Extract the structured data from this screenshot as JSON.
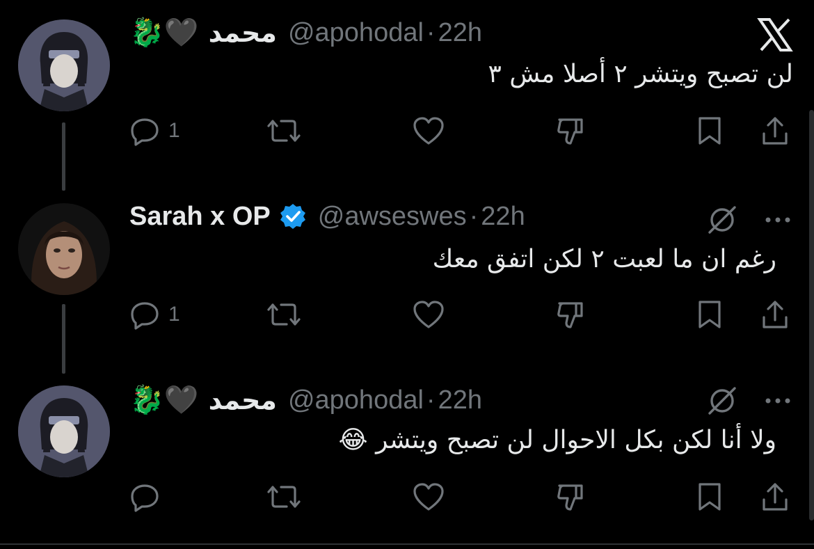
{
  "tweets": [
    {
      "display_name": "محمد",
      "name_emojis": "🐉🖤",
      "handle": "@apohodal",
      "separator": "·",
      "time": "22h",
      "text": "لن تصبح ويتشر ٢ أصلا مش ٣",
      "reply_count": "1",
      "top_icon": "x-logo-icon"
    },
    {
      "display_name": "Sarah x OP",
      "verified": true,
      "handle": "@awseswes",
      "separator": "·",
      "time": "22h",
      "text": "رغم ان ما لعبت ٢ لكن اتفق معك",
      "reply_count": "1",
      "top_icon": "grok-icon"
    },
    {
      "display_name": "محمد",
      "name_emojis": "🐉🖤",
      "handle": "@apohodal",
      "separator": "·",
      "time": "22h",
      "text": "ولا أنا لكن بكل الاحوال لن تصبح ويتشر",
      "text_emoji": "😂",
      "reply_count": "",
      "top_icon": "grok-icon"
    }
  ],
  "colors": {
    "background": "#000000",
    "text": "#e7e9ea",
    "muted": "#71767b",
    "verified": "#1d9bf0",
    "thread_line": "#3a3d40"
  }
}
